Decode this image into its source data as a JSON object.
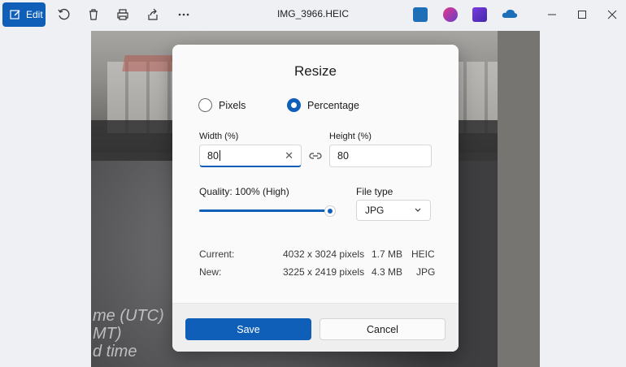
{
  "toolbar": {
    "edit_label": "Edit",
    "icons": [
      "rotate-icon",
      "delete-icon",
      "print-icon",
      "share-icon",
      "more-icon"
    ],
    "window_title": "IMG_3966.HEIC",
    "apps": [
      "app-icon-1",
      "app-icon-2",
      "app-icon-3",
      "onedrive-icon"
    ]
  },
  "dialog": {
    "title": "Resize",
    "mode_options": [
      {
        "label": "Pixels",
        "checked": false
      },
      {
        "label": "Percentage",
        "checked": true
      }
    ],
    "width": {
      "label": "Width  (%)",
      "value": "80"
    },
    "height": {
      "label": "Height  (%)",
      "value": "80"
    },
    "quality": {
      "label": "Quality: 100% (High)",
      "value_percent": 100
    },
    "file_type": {
      "label": "File type",
      "selected": "JPG"
    },
    "current": {
      "label": "Current:",
      "dimensions": "4032 x 3024 pixels",
      "size": "1.7 MB",
      "format": "HEIC"
    },
    "new": {
      "label": "New:",
      "dimensions": "3225 x 2419 pixels",
      "size": "4.3 MB",
      "format": "JPG"
    },
    "save_label": "Save",
    "cancel_label": "Cancel"
  },
  "photo": {
    "overlay_text_1": "me (UTC)",
    "overlay_text_2": "MT)",
    "overlay_text_3": "d time"
  },
  "colors": {
    "accent": "#0f5fb8"
  }
}
